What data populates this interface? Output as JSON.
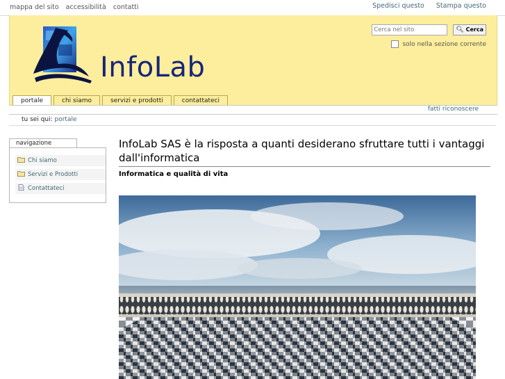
{
  "topbar": {
    "links_left": [
      "mappa del sito",
      "accessibilità",
      "contatti"
    ],
    "links_right": [
      "Spedisci questo",
      "Stampa questo"
    ]
  },
  "header": {
    "logo_text": "InfoLab",
    "search": {
      "placeholder": "Cerca nel sito",
      "button_label": "Cerca",
      "option_label": "solo nella sezione corrente"
    }
  },
  "tabs": [
    "portale",
    "chi siamo",
    "servizi e prodotti",
    "contattateci"
  ],
  "subnav": {
    "right_link": "fatti riconoscere"
  },
  "breadcrumb": {
    "prefix": "tu sei qui:",
    "current": "portale"
  },
  "navigation": {
    "title": "navigazione",
    "items": [
      {
        "label": "Chi siamo",
        "icon": "folder-icon"
      },
      {
        "label": "Servizi e Prodotti",
        "icon": "folder-icon"
      },
      {
        "label": "Contattateci",
        "icon": "page-icon"
      }
    ]
  },
  "main": {
    "title": "InfoLab SAS è la risposta a quanti desiderano sfruttare tutti i vantaggi dall'informatica",
    "subtitle": "Informatica e qualità di vita",
    "image_alt": "terrace-seaside-photo"
  },
  "colors": {
    "header_bg": "#fcee9c",
    "link": "#436976",
    "logo_text": "#17257a"
  }
}
